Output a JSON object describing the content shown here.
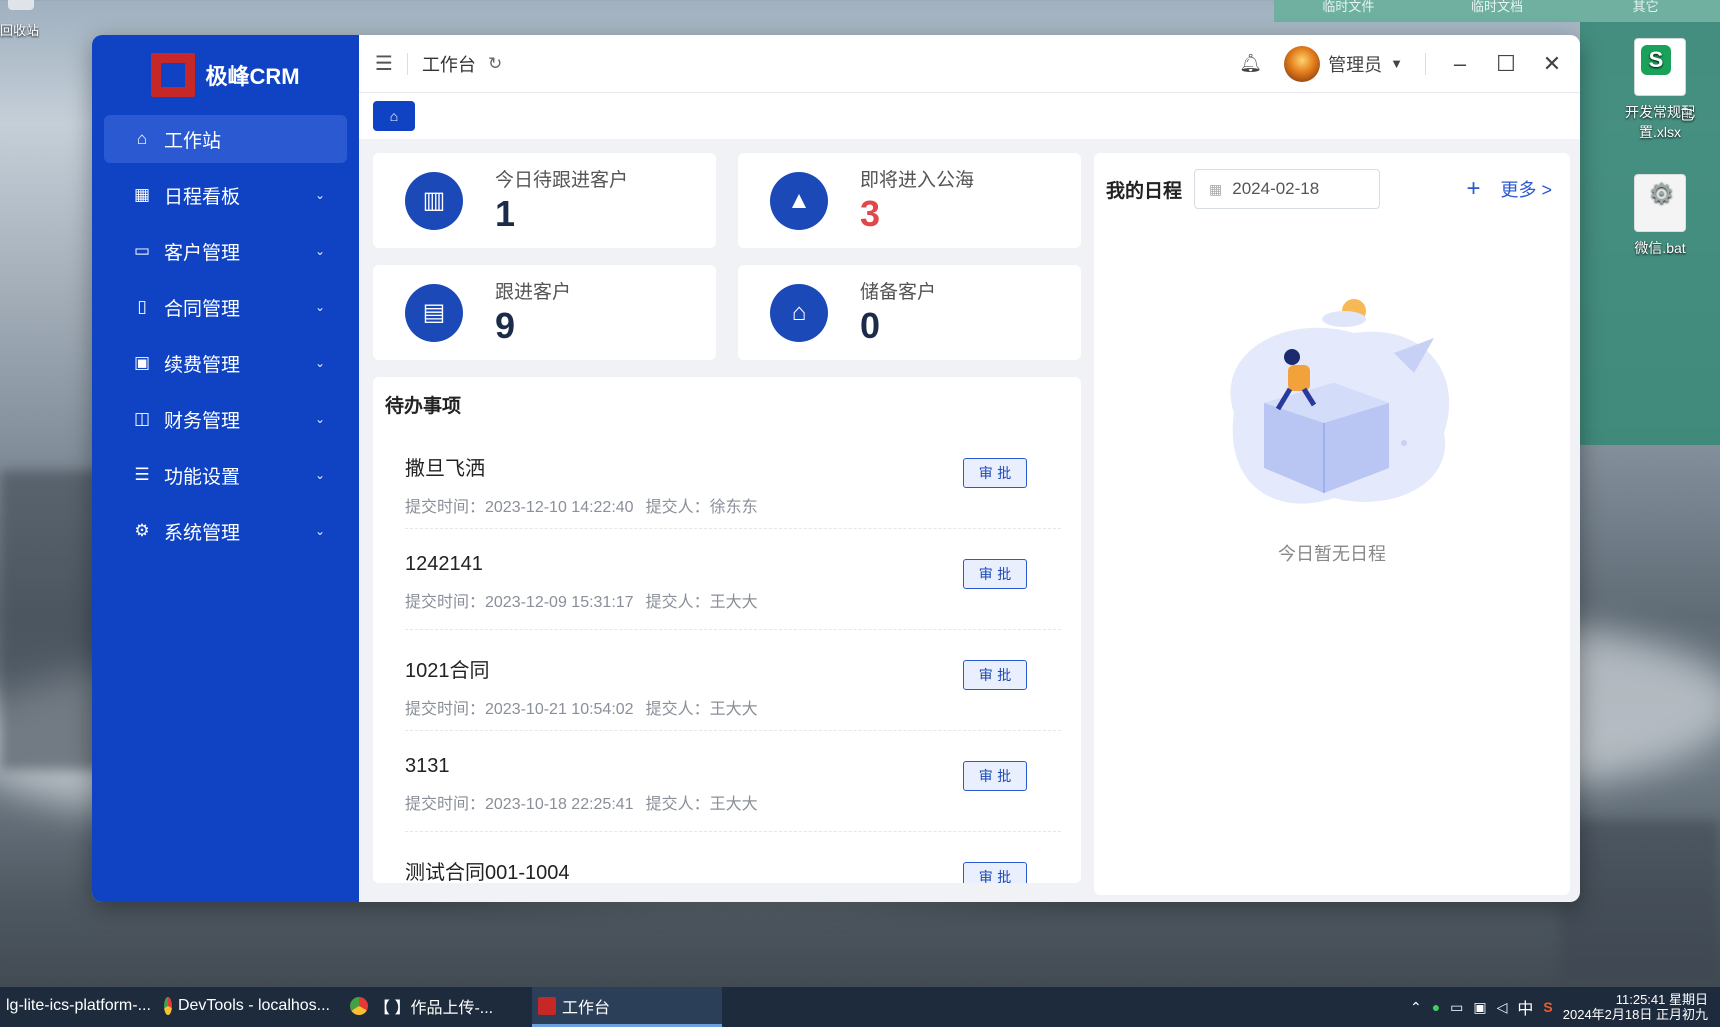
{
  "desktop": {
    "recycle_label": "回收站",
    "right_tabs": [
      "临时文件",
      "临时文档",
      "其它"
    ],
    "icons": [
      {
        "label": "开发常规配置.xlsx",
        "icon": "spreadsheet-icon"
      },
      {
        "label": "微信.bat",
        "icon": "batch-file-icon"
      }
    ],
    "partial_icon_label": "已"
  },
  "app": {
    "logo_text": "极峰CRM",
    "menu": [
      {
        "label": "工作站",
        "icon": "home-icon",
        "active": true
      },
      {
        "label": "日程看板",
        "icon": "calendar-icon"
      },
      {
        "label": "客户管理",
        "icon": "briefcase-icon"
      },
      {
        "label": "合同管理",
        "icon": "book-icon"
      },
      {
        "label": "续费管理",
        "icon": "renew-icon"
      },
      {
        "label": "财务管理",
        "icon": "chart-icon"
      },
      {
        "label": "功能设置",
        "icon": "sliders-icon"
      },
      {
        "label": "系统管理",
        "icon": "gear-icon"
      }
    ],
    "topbar": {
      "breadcrumb": "工作台",
      "user_name": "管理员"
    },
    "stats": [
      {
        "label": "今日待跟进客户",
        "value": "1",
        "icon": "bar-chart-icon"
      },
      {
        "label": "即将进入公海",
        "value": "3",
        "icon": "pyramid-icon",
        "highlight": "#e0484b"
      },
      {
        "label": "跟进客户",
        "value": "9",
        "icon": "building-icon"
      },
      {
        "label": "储备客户",
        "value": "0",
        "icon": "bank-icon"
      }
    ],
    "todo": {
      "title": "待办事项",
      "approve_label": "审 批",
      "items": [
        {
          "name": "撒旦飞洒",
          "time": "提交时间：2023-12-10 14:22:40",
          "submitter": "提交人：徐东东"
        },
        {
          "name": "1242141",
          "time": "提交时间：2023-12-09 15:31:17",
          "submitter": "提交人：王大大"
        },
        {
          "name": "1021合同",
          "time": "提交时间：2023-10-21 10:54:02",
          "submitter": "提交人：王大大"
        },
        {
          "name": "3131",
          "time": "提交时间：2023-10-18 22:25:41",
          "submitter": "提交人：王大大"
        },
        {
          "name": "测试合同001-1004",
          "time": "",
          "submitter": ""
        }
      ]
    },
    "schedule": {
      "title": "我的日程",
      "date": "2024-02-18",
      "more": "更多 >",
      "empty": "今日暂无日程"
    }
  },
  "taskbar": {
    "tasks": [
      {
        "label": "lg-lite-ics-platform-...",
        "icon": ""
      },
      {
        "label": "DevTools - localhos...",
        "icon": "chrome"
      },
      {
        "label": "【        】作品上传-...",
        "icon": "chrome"
      },
      {
        "label": "工作台",
        "icon": "crm",
        "selected": true
      }
    ],
    "ime": "中",
    "clock_time": "11:25:41 星期日",
    "clock_date": "2024年2月18日 正月初九"
  },
  "colors": {
    "sidebar": "#0f43c4",
    "accent": "#1b49b8",
    "alert": "#e0484b"
  }
}
